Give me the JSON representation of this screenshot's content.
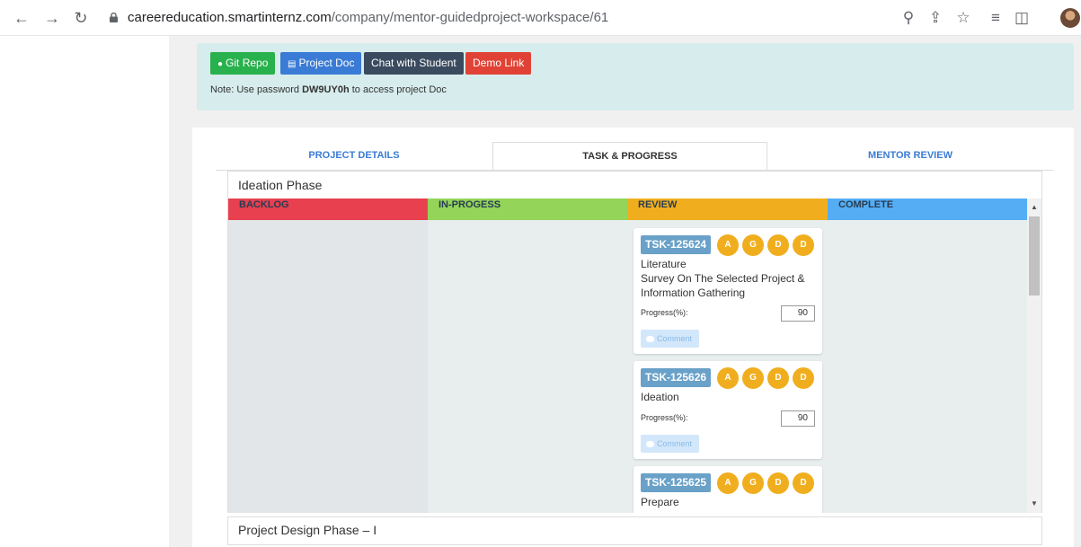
{
  "browser": {
    "url_host": "careereducation.smartinternz.com",
    "url_path": "/company/mentor-guidedproject-workspace/61"
  },
  "actions": {
    "git_repo": "Git Repo",
    "project_doc": "Project Doc",
    "chat": "Chat with Student",
    "demo": "Demo Link"
  },
  "note": {
    "prefix": "Note: Use password ",
    "password": "DW9UY0h",
    "suffix": " to access project Doc"
  },
  "tabs": {
    "details": "PROJECT DETAILS",
    "task": "TASK & PROGRESS",
    "review": "MENTOR REVIEW"
  },
  "phases": [
    {
      "title": "Ideation Phase"
    },
    {
      "title": "Project Design Phase – I"
    }
  ],
  "columns": {
    "backlog": "BACKLOG",
    "progress": "IN-PROGESS",
    "review": "REVIEW",
    "complete": "COMPLETE"
  },
  "tasks": [
    {
      "id": "TSK-125624",
      "initials": [
        "A",
        "G",
        "D",
        "D"
      ],
      "title_line1": "Literature",
      "title_line2": "Survey On The Selected Project & Information Gathering",
      "progress_label": "Progress(%):",
      "progress": "90",
      "comment": "Comment"
    },
    {
      "id": "TSK-125626",
      "initials": [
        "A",
        "G",
        "D",
        "D"
      ],
      "title_line1": "Ideation",
      "progress_label": "Progress(%):",
      "progress": "90",
      "comment": "Comment"
    },
    {
      "id": "TSK-125625",
      "initials": [
        "A",
        "G",
        "D",
        "D"
      ],
      "title_line1": "Prepare"
    }
  ],
  "colors": {
    "backlog": "#e8404f",
    "progress": "#93d459",
    "review": "#f0ae1e",
    "complete": "#55adf4"
  }
}
